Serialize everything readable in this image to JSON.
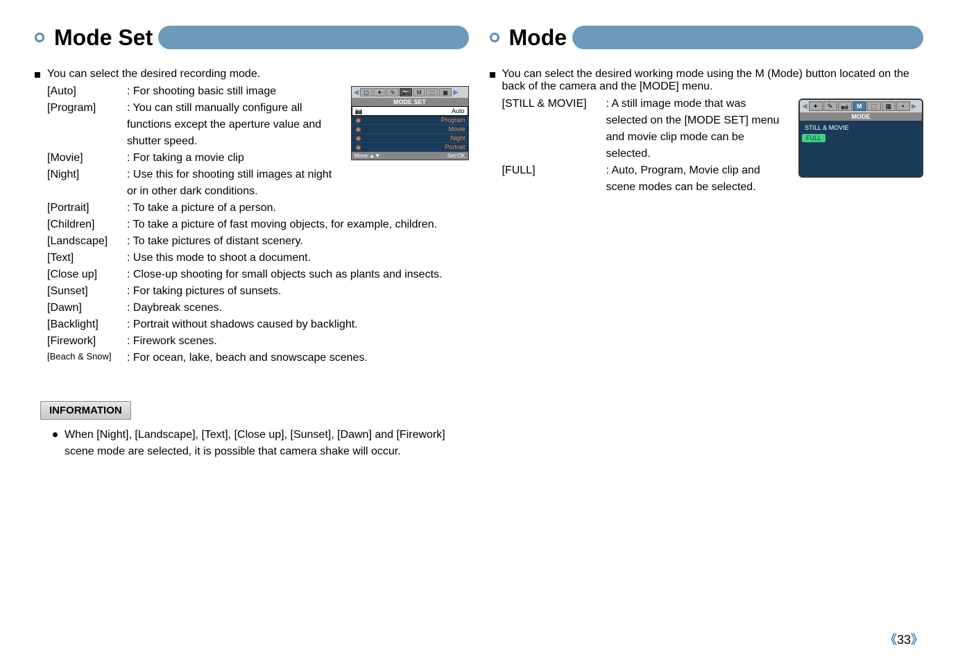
{
  "left": {
    "title": "Mode Set",
    "intro": "You can select the desired recording mode.",
    "modes": [
      {
        "label": "[Auto]",
        "desc": "For shooting basic still image"
      },
      {
        "label": "[Program]",
        "desc": "You can still manually configure all functions except the aperture value and shutter speed."
      },
      {
        "label": "[Movie]",
        "desc": "For taking a movie clip"
      },
      {
        "label": "[Night]",
        "desc": "Use this for shooting still images at night or in other dark conditions."
      },
      {
        "label": "[Portrait]",
        "desc": "To take a picture of a person."
      },
      {
        "label": "[Children]",
        "desc": "To take a picture of fast moving objects, for example, children."
      },
      {
        "label": "[Landscape]",
        "desc": "To take pictures of distant scenery."
      },
      {
        "label": "[Text]",
        "desc": "Use this mode to shoot a document."
      },
      {
        "label": "[Close up]",
        "desc": "Close-up shooting for small objects such as plants and insects."
      },
      {
        "label": "[Sunset]",
        "desc": "For taking pictures of sunsets."
      },
      {
        "label": "[Dawn]",
        "desc": "Daybreak scenes."
      },
      {
        "label": "[Backlight]",
        "desc": "Portrait without shadows caused by backlight."
      },
      {
        "label": "[Firework]",
        "desc": "Firework scenes."
      },
      {
        "label": "[Beach & Snow]",
        "desc": "For ocean, lake, beach and snowscape scenes.",
        "small": true
      }
    ],
    "mini": {
      "title": "MODE SET",
      "items": [
        {
          "name": "Auto",
          "selected": true
        },
        {
          "name": "Program"
        },
        {
          "name": "Movie"
        },
        {
          "name": "Night"
        },
        {
          "name": "Portrait"
        }
      ],
      "footer_left": "Move",
      "footer_right": "Set:OK"
    },
    "info": {
      "header": "INFORMATION",
      "text": "When [Night], [Landscape], [Text], [Close up], [Sunset], [Dawn] and [Firework] scene mode are selected, it is possible that camera shake will occur."
    }
  },
  "right": {
    "title": "Mode",
    "intro": "You can select the desired working mode using the M (Mode) button located on the back of the camera and the [MODE] menu.",
    "options": [
      {
        "label": "[STILL & MOVIE]",
        "desc": "A still image mode that was selected on the [MODE SET] menu and movie clip mode can be selected."
      },
      {
        "label": "[FULL]",
        "desc": "Auto, Program, Movie clip and scene modes can be selected."
      }
    ],
    "mini": {
      "title": "MODE",
      "m_label": "M",
      "opt1": "STILL & MOVIE",
      "opt2": "FULL"
    }
  },
  "page_number": "33"
}
